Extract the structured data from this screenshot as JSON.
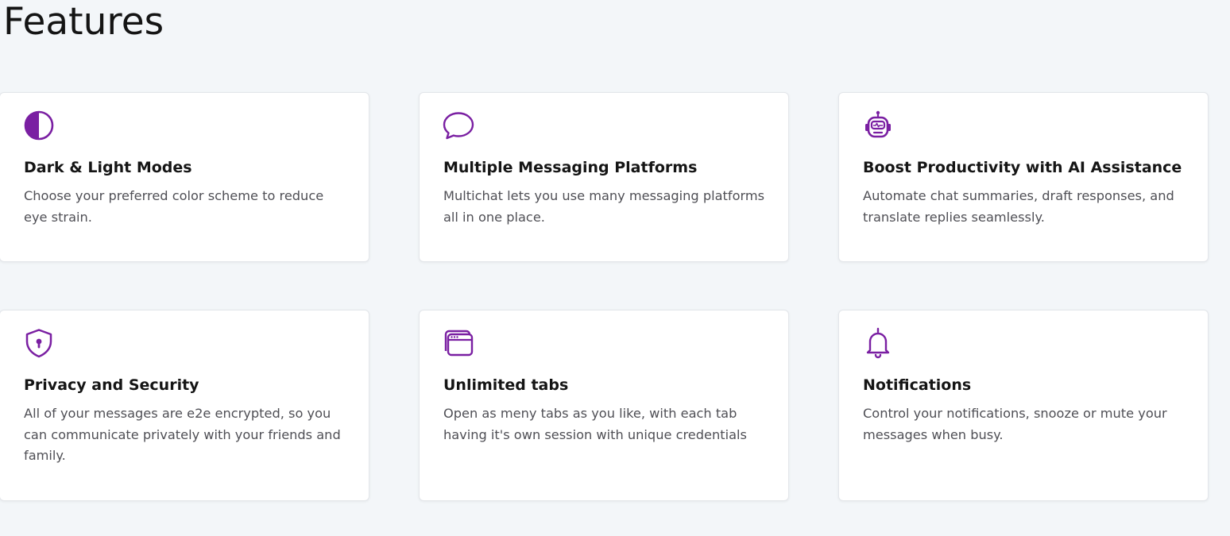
{
  "page": {
    "title": "Features"
  },
  "colors": {
    "accent": "#7a1fa2",
    "background": "#f3f6f9",
    "card": "#ffffff",
    "heading": "#151515",
    "body_text": "#4f4f55"
  },
  "features": [
    {
      "icon": "half-circle-contrast-icon",
      "title": "Dark & Light Modes",
      "description": "Choose your preferred color scheme to reduce eye strain."
    },
    {
      "icon": "chat-bubble-icon",
      "title": "Multiple Messaging Platforms",
      "description": "Multichat lets you use many messaging platforms all in one place."
    },
    {
      "icon": "robot-icon",
      "title": "Boost Productivity with AI Assistance",
      "description": "Automate chat summaries, draft responses, and translate replies seamlessly."
    },
    {
      "icon": "shield-lock-icon",
      "title": "Privacy and Security",
      "description": "All of your messages are e2e encrypted, so you can communicate privately with your friends and family."
    },
    {
      "icon": "browser-tabs-icon",
      "title": "Unlimited tabs",
      "description": "Open as meny tabs as you like, with each tab having it's own session with unique credentials"
    },
    {
      "icon": "bell-icon",
      "title": "Notifications",
      "description": "Control your notifications, snooze or mute your messages when busy."
    }
  ]
}
